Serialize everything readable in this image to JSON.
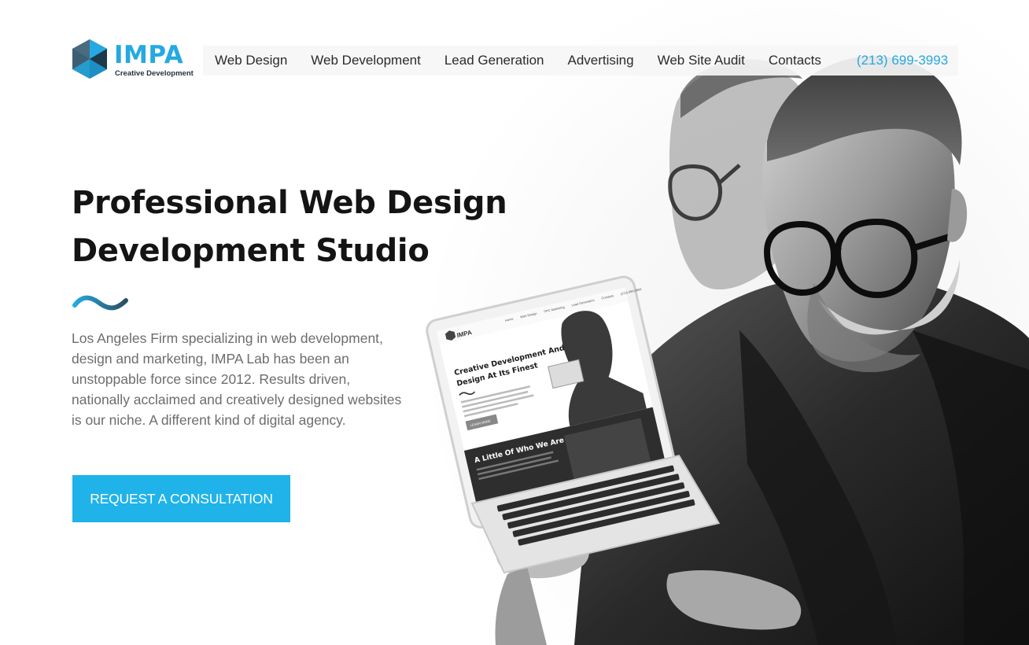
{
  "brand": {
    "name": "IMPA",
    "tagline": "Creative Development",
    "accent_color": "#25a9e0",
    "logo_icon": "hexagon-cube-logo-icon"
  },
  "nav": {
    "items": [
      {
        "label": "Web Design"
      },
      {
        "label": "Web Development"
      },
      {
        "label": "Lead Generation"
      },
      {
        "label": "Advertising"
      },
      {
        "label": "Web Site Audit"
      },
      {
        "label": "Contacts"
      }
    ],
    "phone": "(213) 699-3993"
  },
  "hero": {
    "title_line1": "Professional Web Design",
    "title_line2": "Development Studio",
    "description": "Los Angeles Firm specializing in web development, design and marketing, IMPA Lab has been an unstoppable force since 2012. Results driven, nationally acclaimed and creatively designed websites is our niche. A different kind of digital agency.",
    "cta_label": "REQUEST A CONSULTATION",
    "cta_color": "#1fb3ea",
    "divider_icon": "wave-divider-icon"
  },
  "laptop_screen": {
    "logo": "IMPA",
    "nav": [
      "Home",
      "Web Design",
      "PPC Marketing",
      "Lead Generation",
      "Contacts",
      "(213) 699-3993"
    ],
    "headline_line1": "Creative Development And",
    "headline_line2": "Design At Its Finest",
    "button": "LEARN MORE",
    "section_title": "A Little Of Who We Are"
  }
}
